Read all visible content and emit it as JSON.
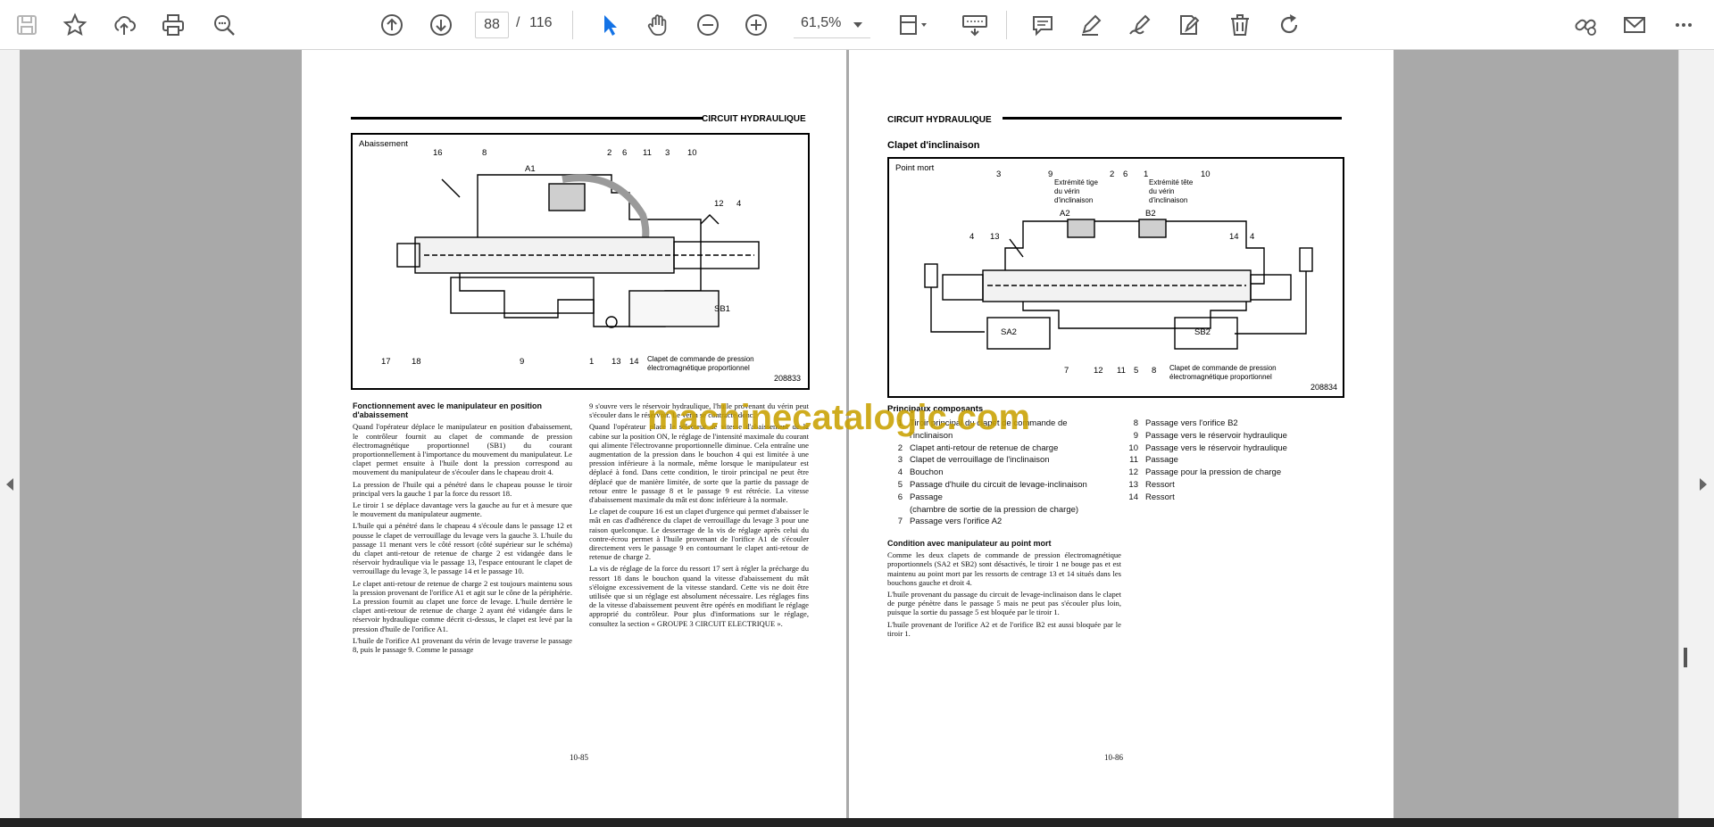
{
  "toolbar": {
    "current_page": "88",
    "page_separator": "/",
    "total_pages": "116",
    "zoom": "61,5%"
  },
  "icons": [
    "save-icon",
    "bookmark-star-icon",
    "upload-cloud-icon",
    "print-icon",
    "find-zoom-icon",
    "page-up-icon",
    "page-down-icon",
    "select-cursor-icon",
    "hand-tool-icon",
    "zoom-out-icon",
    "zoom-in-icon",
    "page-fit-icon",
    "keyboard-icon",
    "comment-icon",
    "pen-icon",
    "draw-icon",
    "fill-sign-icon",
    "delete-icon",
    "rotate-icon",
    "share-link-icon",
    "email-icon",
    "more-icon"
  ],
  "accent_color": "#1473e6",
  "left_page": {
    "running_head": "CIRCUIT HYDRAULIQUE",
    "figure": {
      "caption": "Abaissement",
      "number": "208833",
      "callouts": [
        "16",
        "8",
        "A1",
        "2",
        "6",
        "11",
        "3",
        "10",
        "12",
        "4",
        "SB1",
        "17",
        "18",
        "9",
        "1",
        "13",
        "14"
      ],
      "note": "Clapet de commande de pression électromagnétique proportionnel"
    },
    "col1": {
      "heading": "Fonctionnement avec le manipulateur en position d'abaissement",
      "paragraphs": [
        "Quand l'opérateur déplace le manipulateur en position d'abaissement, le contrôleur fournit au clapet de commande de pression électromagnétique proportionnel (SB1) du courant proportionnellement à l'importance du mouvement du manipulateur. Le clapet permet ensuite à l'huile dont la pression correspond au mouvement du manipulateur de s'écouler dans le chapeau droit 4.",
        "La pression de l'huile qui a pénétré dans le chapeau pousse le tiroir principal vers la gauche 1 par la force du ressort 18.",
        "Le tiroir 1 se déplace davantage vers la gauche au fur et à mesure que le mouvement du manipulateur augmente.",
        "L'huile qui a pénétré dans le chapeau 4 s'écoule dans le passage 12 et pousse le clapet de verrouillage du levage vers la gauche 3. L'huile du passage 11 menant vers le côté ressort (côté supérieur sur le schéma) du clapet anti-retour de retenue de charge 2 est vidangée dans le réservoir hydraulique via le passage 13, l'espace entourant le clapet de verrouillage du levage 3, le passage 14 et le passage 10.",
        "Le clapet anti-retour de retenue de charge 2 est toujours maintenu sous la pression provenant de l'orifice A1 et agit sur le cône de la périphérie. La pression fournit au clapet une force de levage. L'huile derrière le clapet anti-retour de retenue de charge 2 ayant été vidangée dans le réservoir hydraulique comme décrit ci-dessus, le clapet est levé par la pression d'huile de l'orifice A1.",
        "L'huile de l'orifice A1 provenant du vérin de levage traverse le passage 8, puis le passage 9. Comme le passage"
      ]
    },
    "col2": {
      "paragraphs": [
        "9 s'ouvre vers le réservoir hydraulique, l'huile provenant du vérin peut s'écouler dans le réservoir. Le vérin se contracte donc.",
        "Quand l'opérateur place le sélecteur de vitesse d'abaissement de la cabine sur la position ON, le réglage de l'intensité maximale du courant qui alimente l'électrovanne proportionnelle diminue. Cela entraîne une augmentation de la pression dans le bouchon 4 qui est limitée à une pression inférieure à la normale, même lorsque le manipulateur est déplacé à fond. Dans cette condition, le tiroir principal ne peut être déplacé que de manière limitée, de sorte que la partie du passage de retour entre le passage 8 et le passage 9 est rétrécie. La vitesse d'abaissement maximale du mât est donc inférieure à la normale.",
        "Le clapet de coupure 16 est un clapet d'urgence qui permet d'abaisser le mât en cas d'adhérence du clapet de verrouillage du levage 3 pour une raison quelconque. Le desserrage de la vis de réglage après celui du contre-écrou permet à l'huile provenant de l'orifice A1 de s'écouler directement vers le passage 9 en contournant le clapet anti-retour de retenue de charge 2.",
        "La vis de réglage de la force du ressort 17 sert à régler la précharge du ressort 18 dans le bouchon quand la vitesse d'abaissement du mât s'éloigne excessivement de la vitesse standard. Cette vis ne doit être utilisée que si un réglage est absolument nécessaire. Les réglages fins de la vitesse d'abaissement peuvent être opérés en modifiant le réglage approprié du contrôleur. Pour plus d'informations sur le réglage, consultez la section « GROUPE 3 CIRCUIT ELECTRIQUE »."
      ]
    },
    "footer": "10-85"
  },
  "right_page": {
    "running_head": "CIRCUIT HYDRAULIQUE",
    "section_title": "Clapet d'inclinaison",
    "figure": {
      "caption": "Point mort",
      "number": "208834",
      "callouts": [
        "3",
        "9",
        "2",
        "6",
        "1",
        "10",
        "A2",
        "B2",
        "4",
        "13",
        "14",
        "4",
        "SA2",
        "SB2",
        "7",
        "12",
        "11",
        "5",
        "8"
      ],
      "label_left": "Extrémité tige du vérin d'inclinaison",
      "label_right": "Extrémité tête du vérin d'inclinaison",
      "note": "Clapet de commande de pression électromagnétique proportionnel"
    },
    "components_title": "Principaux composants",
    "components_left": [
      {
        "n": "1",
        "t": "Tiroir principal du clapet de commande de l'inclinaison"
      },
      {
        "n": "2",
        "t": "Clapet anti-retour de retenue de charge"
      },
      {
        "n": "3",
        "t": "Clapet de verrouillage de l'inclinaison"
      },
      {
        "n": "4",
        "t": "Bouchon"
      },
      {
        "n": "5",
        "t": "Passage d'huile du circuit de levage-inclinaison"
      },
      {
        "n": "6",
        "t": "Passage"
      },
      {
        "n": "",
        "t": "(chambre de sortie de la pression de charge)"
      },
      {
        "n": "7",
        "t": "Passage vers l'orifice A2"
      }
    ],
    "components_right": [
      {
        "n": "8",
        "t": "Passage vers l'orifice B2"
      },
      {
        "n": "9",
        "t": "Passage vers le réservoir hydraulique"
      },
      {
        "n": "10",
        "t": "Passage vers le réservoir hydraulique"
      },
      {
        "n": "11",
        "t": "Passage"
      },
      {
        "n": "12",
        "t": "Passage pour la pression de charge"
      },
      {
        "n": "13",
        "t": "Ressort"
      },
      {
        "n": "14",
        "t": "Ressort"
      }
    ],
    "col1": {
      "heading": "Condition avec manipulateur au point mort",
      "paragraphs": [
        "Comme les deux clapets de commande de pression électromagnétique proportionnels (SA2 et SB2) sont désactivés, le tiroir 1 ne bouge pas et est maintenu au point mort par les ressorts de centrage 13 et 14 situés dans les bouchons gauche et droit 4.",
        "L'huile provenant du passage du circuit de levage-inclinaison dans le clapet de purge pénètre dans le passage 5 mais ne peut pas s'écouler plus loin, puisque la sortie du passage 5 est bloquée par le tiroir 1.",
        "L'huile provenant de l'orifice A2 et de l'orifice B2 est aussi bloquée par le tiroir 1."
      ]
    },
    "footer": "10-86"
  },
  "watermark": "machinecatalogic.com"
}
